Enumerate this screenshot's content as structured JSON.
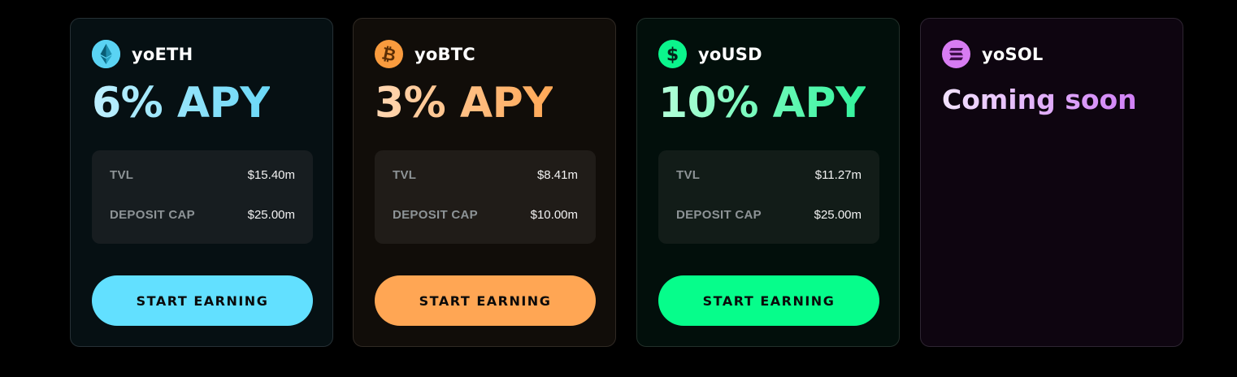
{
  "cards": [
    {
      "name": "yoETH",
      "icon": "ethereum-icon",
      "apy": "6% APY",
      "tvl_label": "TVL",
      "tvl_value": "$15.40m",
      "cap_label": "DEPOSIT CAP",
      "cap_value": "$25.00m",
      "button_label": "START EARNING",
      "accent": "#62e0ff"
    },
    {
      "name": "yoBTC",
      "icon": "bitcoin-icon",
      "apy": "3% APY",
      "tvl_label": "TVL",
      "tvl_value": "$8.41m",
      "cap_label": "DEPOSIT CAP",
      "cap_value": "$10.00m",
      "button_label": "START EARNING",
      "accent": "#ffa654"
    },
    {
      "name": "yoUSD",
      "icon": "dollar-icon",
      "apy": "10% APY",
      "tvl_label": "TVL",
      "tvl_value": "$11.27m",
      "cap_label": "DEPOSIT CAP",
      "cap_value": "$25.00m",
      "button_label": "START EARNING",
      "accent": "#06fd8b"
    },
    {
      "name": "yoSOL",
      "icon": "solana-icon",
      "status": "Coming soon",
      "accent": "#d07ff6"
    }
  ]
}
